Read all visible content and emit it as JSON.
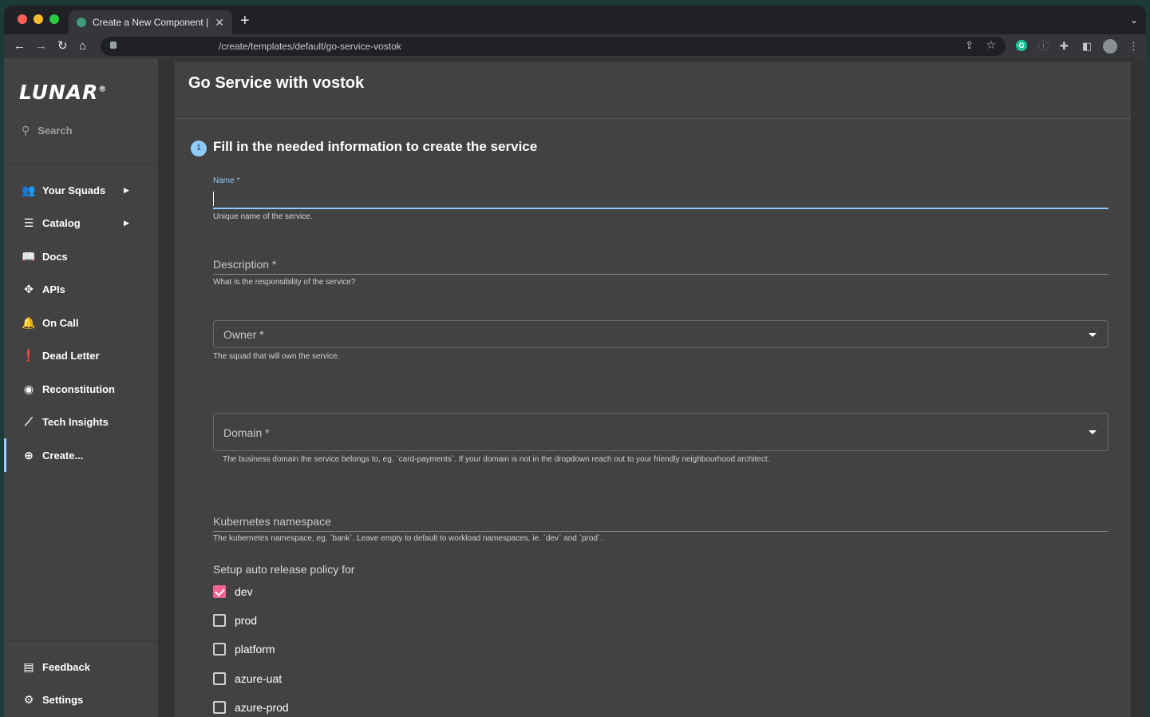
{
  "browser": {
    "tab_title": "Create a New Component | Lunar",
    "url": "/create/templates/default/go-service-vostok",
    "colors": {
      "close": "#ff5f57",
      "minimize": "#febc2e",
      "maximize": "#28c840"
    }
  },
  "sidebar": {
    "logo": "LUNAR",
    "logo_mark": "®",
    "search_label": "Search",
    "items": [
      {
        "label": "Your Squads",
        "icon": "people-icon",
        "glyph": "👥",
        "has_arrow": true
      },
      {
        "label": "Catalog",
        "icon": "list-icon",
        "glyph": "☰",
        "has_arrow": true
      },
      {
        "label": "Docs",
        "icon": "book-icon",
        "glyph": "📖"
      },
      {
        "label": "APIs",
        "icon": "api-icon",
        "glyph": "✥"
      },
      {
        "label": "On Call",
        "icon": "bell-icon",
        "glyph": "🔔"
      },
      {
        "label": "Dead Letter",
        "icon": "feedback-icon",
        "glyph": "❗"
      },
      {
        "label": "Reconstitution",
        "icon": "compass-icon",
        "glyph": "◉"
      },
      {
        "label": "Tech Insights",
        "icon": "chart-line-icon",
        "glyph": "⟋"
      },
      {
        "label": "Create...",
        "icon": "add-circle-icon",
        "glyph": "⊕",
        "active": true
      }
    ],
    "bottom_items": [
      {
        "label": "Feedback",
        "icon": "comment-icon",
        "glyph": "▤"
      },
      {
        "label": "Settings",
        "icon": "gear-icon",
        "glyph": "⚙"
      }
    ]
  },
  "main": {
    "title": "Go Service with vostok",
    "step_number": "1",
    "step_title": "Fill in the needed information to create the service",
    "fields": {
      "name": {
        "label": "Name *",
        "value": "",
        "helper": "Unique name of the service."
      },
      "description": {
        "label": "Description *",
        "helper": "What is the responsibility of the service?"
      },
      "owner": {
        "label": "Owner *",
        "helper": "The squad that will own the service."
      },
      "domain": {
        "label": "Domain *",
        "helper": "The business domain the service belongs to, eg. `card-payments`. If your domain is not in the dropdown reach out to your friendly neighbourhood architect."
      },
      "namespace": {
        "label": "Kubernetes namespace",
        "helper": "The kubernetes namespace, eg. `bank`. Leave empty to default to workload namespaces, ie. `dev` and `prod`."
      }
    },
    "release_policy": {
      "label": "Setup auto release policy for",
      "options": [
        {
          "label": "dev",
          "checked": true
        },
        {
          "label": "prod",
          "checked": false
        },
        {
          "label": "platform",
          "checked": false
        },
        {
          "label": "azure-uat",
          "checked": false
        },
        {
          "label": "azure-prod",
          "checked": false
        }
      ]
    }
  }
}
